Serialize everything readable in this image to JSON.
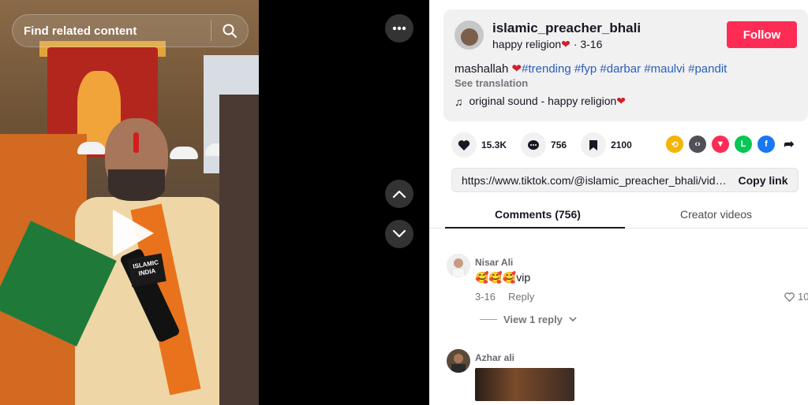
{
  "search": {
    "placeholder": "Find related content"
  },
  "video": {
    "mic_label": "ISLAMIC INDIA"
  },
  "author": {
    "username": "islamic_preacher_bhali",
    "nickname": "happy religion",
    "date": "3-16",
    "follow_label": "Follow"
  },
  "caption": {
    "text": "mashallah",
    "hashtags": [
      "#trending",
      "#fyp",
      "#darbar",
      "#maulvi",
      "#pandit"
    ],
    "see_translation": "See translation"
  },
  "sound": {
    "label": "original sound - happy religion"
  },
  "stats": {
    "likes": "15.3K",
    "comments": "756",
    "saves": "2100"
  },
  "share_icons": [
    "repost-icon",
    "embed-icon",
    "send-icon",
    "line-icon",
    "facebook-icon",
    "forward-icon"
  ],
  "link": {
    "url": "https://www.tiktok.com/@islamic_preacher_bhali/video/...",
    "copy_label": "Copy link"
  },
  "tabs": {
    "comments": "Comments (756)",
    "creator": "Creator videos"
  },
  "comments": [
    {
      "name": "Nisar Ali",
      "text": "🥰🥰🥰vip",
      "date": "3-16",
      "reply_label": "Reply",
      "likes": "10",
      "view_replies": "View 1 reply"
    },
    {
      "name": "Azhar ali"
    }
  ],
  "colors": {
    "follow": "#fe2c55",
    "hashtag": "#2b5db9",
    "text": "#161823",
    "secondary": "#75757c"
  }
}
